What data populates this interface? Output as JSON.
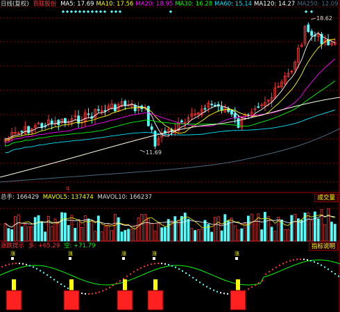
{
  "header": {
    "period_label": "日线(复权)",
    "stock_name": "百联股份",
    "ma_items": [
      {
        "label": "MA5: 17.69",
        "color": "#ffffff"
      },
      {
        "label": "MA10: 17.56",
        "color": "#ffff00"
      },
      {
        "label": "MA20: 18.95",
        "color": "#ff00ff"
      },
      {
        "label": "MA30: 16.28",
        "color": "#00ff00"
      },
      {
        "label": "MA60: 15.14",
        "color": "#00e5ff"
      },
      {
        "label": "MA120: 14.27",
        "color": "#ffffff"
      },
      {
        "label": "MA250: 12.09",
        "color": "#4a6a80"
      }
    ]
  },
  "price_chart": {
    "high_label": "18.62",
    "low_label": "11.69",
    "q_marker": "q"
  },
  "volume": {
    "total_label": "总手: 166429",
    "mavol5_label": "MAVOL5: 137474",
    "mavol10_label": "MAVOL10: 166237",
    "button_label": "成交量"
  },
  "indicator": {
    "title": "涨跌提示",
    "duo_label": "多: +65.29",
    "kong_label": "空: +71.79",
    "button_label": "指标说明",
    "signal_char": "涨"
  },
  "colors": {
    "up": "#ff3333",
    "down": "#54ffff",
    "grid": "#8b0000",
    "text_red": "#ff3333",
    "text_yellow": "#ffff00"
  }
}
